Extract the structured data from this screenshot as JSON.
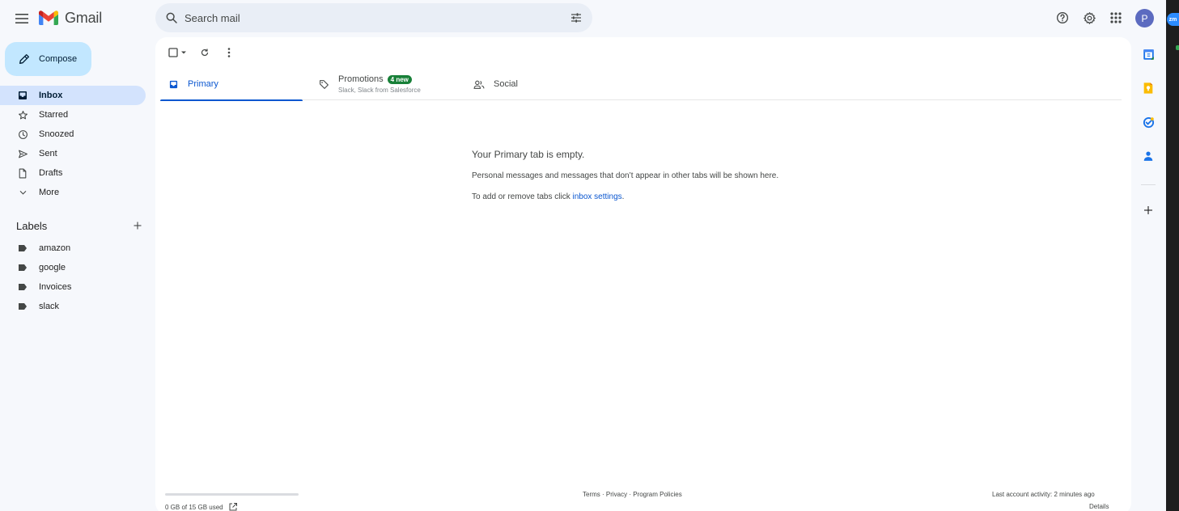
{
  "header": {
    "app_name": "Gmail",
    "search_placeholder": "Search mail",
    "avatar_initial": "P"
  },
  "compose": {
    "label": "Compose"
  },
  "nav": {
    "items": [
      {
        "label": "Inbox",
        "icon": "inbox-icon",
        "active": true
      },
      {
        "label": "Starred",
        "icon": "star-icon"
      },
      {
        "label": "Snoozed",
        "icon": "clock-icon"
      },
      {
        "label": "Sent",
        "icon": "send-icon"
      },
      {
        "label": "Drafts",
        "icon": "draft-icon"
      },
      {
        "label": "More",
        "icon": "chevron-down-icon"
      }
    ]
  },
  "labels": {
    "title": "Labels",
    "items": [
      {
        "label": "amazon"
      },
      {
        "label": "google"
      },
      {
        "label": "Invoices"
      },
      {
        "label": "slack"
      }
    ]
  },
  "tabs": [
    {
      "label": "Primary",
      "icon": "inbox-icon",
      "active": true
    },
    {
      "label": "Promotions",
      "badge": "4 new",
      "subtitle": "Slack, Slack from Salesforce",
      "icon": "tag-icon"
    },
    {
      "label": "Social",
      "icon": "people-icon"
    }
  ],
  "empty_state": {
    "heading": "Your Primary tab is empty.",
    "message": "Personal messages and messages that don’t appear in other tabs will be shown here.",
    "settings_prefix": "To add or remove tabs click ",
    "settings_link": "inbox settings",
    "settings_suffix": "."
  },
  "footer": {
    "storage": "0 GB of 15 GB used",
    "storage_fraction": 0,
    "terms": "Terms",
    "privacy": "Privacy",
    "policies": "Program Policies",
    "separator": " · ",
    "last_activity": "Last account activity: 2 minutes ago",
    "details": "Details"
  },
  "side_panel": {
    "zoom_badge": "zm"
  },
  "colors": {
    "accent": "#0b57d0",
    "compose_bg": "#c2e7ff",
    "active_nav_bg": "#d3e3fd",
    "badge_green": "#188038"
  }
}
